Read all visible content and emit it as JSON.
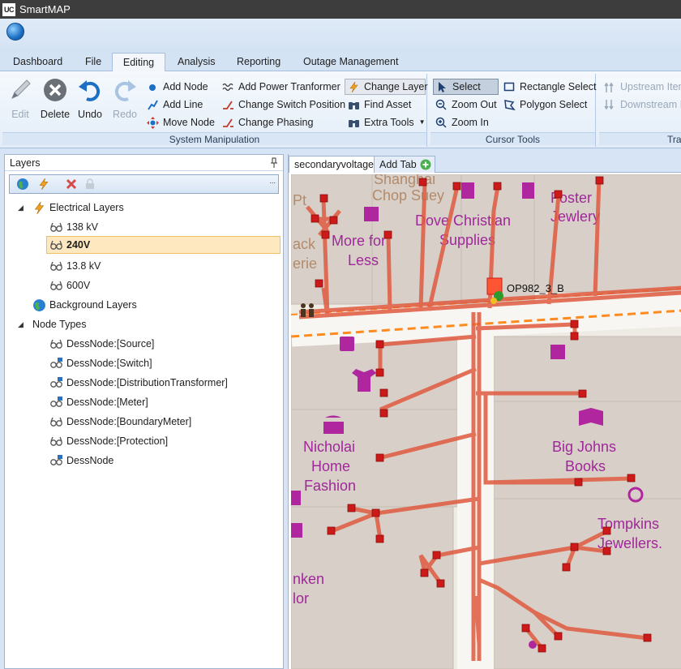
{
  "app": {
    "icon_text": "UC",
    "title": "SmartMAP"
  },
  "tabs": [
    "Dashboard",
    "File",
    "Editing",
    "Analysis",
    "Reporting",
    "Outage Management"
  ],
  "active_tab": "Editing",
  "ribbon": {
    "system_manipulation": {
      "label": "System Manipulation",
      "big_buttons": {
        "edit": "Edit",
        "delete": "Delete",
        "undo": "Undo",
        "redo": "Redo"
      },
      "col1": [
        "Add Node",
        "Add Line",
        "Move Node"
      ],
      "col2": [
        "Add Power Tranformer",
        "Change Switch Position",
        "Change Phasing"
      ],
      "col3": [
        "Change Layer",
        "Find Asset",
        "Extra Tools"
      ]
    },
    "cursor_tools": {
      "label": "Cursor Tools",
      "col1": [
        "Select",
        "Zoom Out",
        "Zoom In"
      ],
      "col2": [
        "Rectangle Select",
        "Polygon Select"
      ]
    },
    "trace": {
      "label": "Trac",
      "items": [
        "Upstream Item",
        "Downstream It"
      ]
    }
  },
  "layers_panel": {
    "title": "Layers",
    "tree": {
      "electrical": "Electrical Layers",
      "electrical_children": [
        "138 kV",
        "240V",
        "13.8 kV",
        "600V"
      ],
      "selected": "240V",
      "background": "Background Layers",
      "node_types": "Node Types",
      "node_children": [
        "DessNode:[Source]",
        "DessNode:[Switch]",
        "DessNode:[DistributionTransformer]",
        "DessNode:[Meter]",
        "DessNode:[BoundaryMeter]",
        "DessNode:[Protection]",
        "DessNode"
      ]
    }
  },
  "map": {
    "tabs": [
      "secondaryvoltage",
      "Add Tab"
    ],
    "node_label": "OP982_3_B",
    "place_labels": {
      "shanghai": [
        "Shanghai",
        "Chop Suey"
      ],
      "dove": [
        "Dove Christian",
        "Supplies"
      ],
      "foster": [
        "Foster",
        "Jewlery"
      ],
      "morefor": [
        "More for",
        "Less"
      ],
      "nicholai": [
        "Nicholai",
        "Home",
        "Fashion"
      ],
      "bigjohns": [
        "Big Johns",
        "Books"
      ],
      "tompkins": [
        "Tompkins",
        "Jewellers."
      ],
      "pt": "Pt",
      "ack": [
        "ack",
        "erie"
      ],
      "nken": [
        "nken",
        "lor"
      ]
    }
  },
  "colors": {
    "accent": "#1d6fc4",
    "line": "#e05a3f",
    "node": "#cc1a1a",
    "poi": "#b0269e",
    "poi_text": "#a0279a",
    "dashed": "#ff8a1e"
  }
}
